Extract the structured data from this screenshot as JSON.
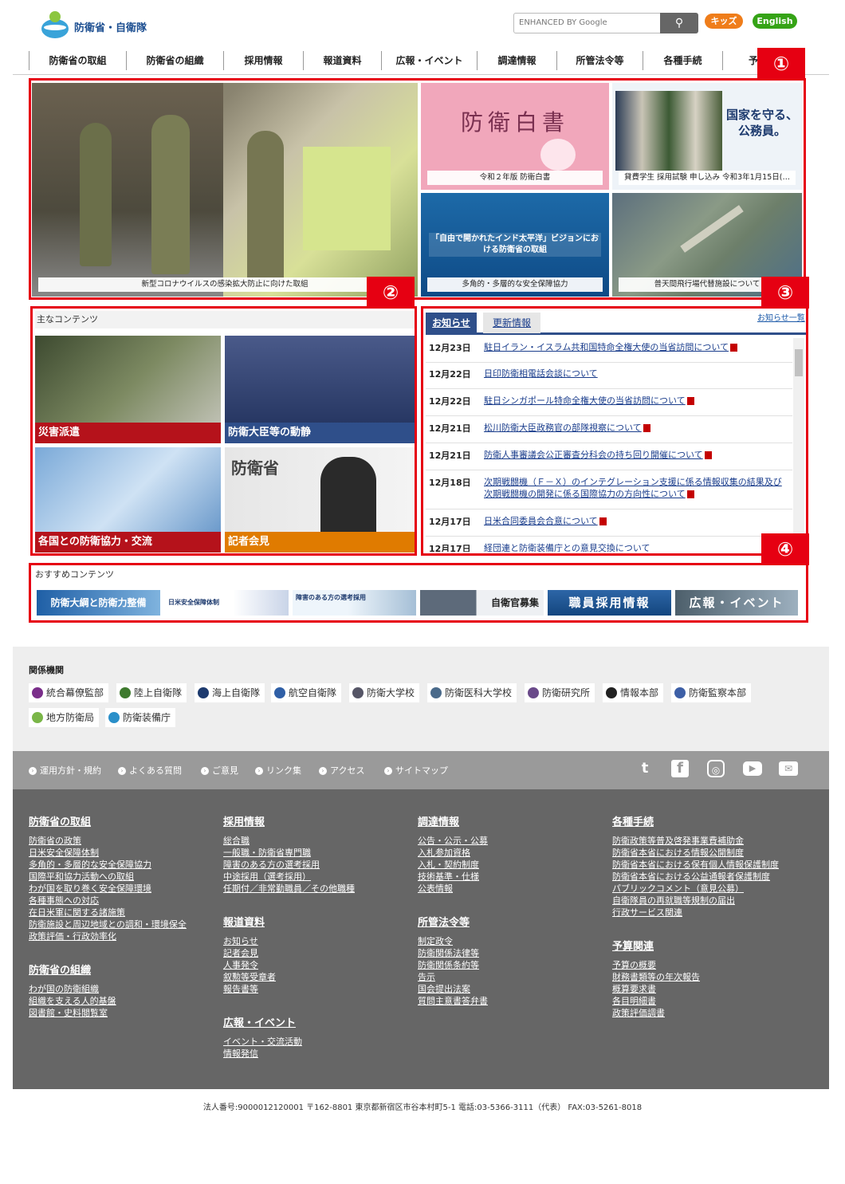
{
  "header": {
    "logo_text": "防衛省・自衛隊",
    "search_placeholder": "ENHANCED BY Google",
    "kids_label": "キッズ",
    "english_label": "English"
  },
  "global_nav": [
    "防衛省の取組",
    "防衛省の組織",
    "採用情報",
    "報道資料",
    "広報・イベント",
    "調達情報",
    "所管法令等",
    "各種手続",
    "予算"
  ],
  "markers": [
    "①",
    "②",
    "③",
    "④"
  ],
  "hero": {
    "main_caption": "新型コロナウイルスの感染拡大防止に向けた取組",
    "tiles": [
      {
        "caption": "令和２年版 防衛白書",
        "art_title": "防衛白書"
      },
      {
        "caption": "貸費学生 採用試験 申し込み 令和3年1月15日(…",
        "art_title": "国家を守る、公務員。"
      },
      {
        "caption": "多角的・多層的な安全保障協力",
        "art_title": "「自由で開かれたインド太平洋」ビジョンにおける防衛省の取組"
      },
      {
        "caption": "普天間飛行場代替施設について"
      }
    ]
  },
  "main_contents": {
    "title": "主なコンテンツ",
    "tiles": [
      "災害派遣",
      "防衛大臣等の動静",
      "各国との防衛協力・交流",
      "記者会見"
    ]
  },
  "news": {
    "tab_active": "お知らせ",
    "tab_inactive": "更新情報",
    "all_link": "お知らせ一覧",
    "items": [
      {
        "date": "12月23日",
        "title": "駐日イラン・イスラム共和国特命全権大使の当省訪問について",
        "pdf": true
      },
      {
        "date": "12月22日",
        "title": "日印防衛相電話会談について",
        "pdf": false
      },
      {
        "date": "12月22日",
        "title": "駐日シンガポール特命全権大使の当省訪問について",
        "pdf": true
      },
      {
        "date": "12月21日",
        "title": "松川防衛大臣政務官の部隊視察について",
        "pdf": true
      },
      {
        "date": "12月21日",
        "title": "防衛人事審議会公正審査分科会の持ち回り開催について",
        "pdf": true
      },
      {
        "date": "12月18日",
        "title": "次期戦闘機（Ｆ－Ｘ）のインテグレーション支援に係る情報収集の結果及び次期戦闘機の開発に係る国際協力の方向性について",
        "pdf": true
      },
      {
        "date": "12月17日",
        "title": "日米合同委員会合意について",
        "pdf": true
      },
      {
        "date": "12月17日",
        "title": "経団連と防衛装備庁との意見交換について",
        "pdf": false
      }
    ]
  },
  "recommended": {
    "title": "おすすめコンテンツ",
    "banners": [
      "防衛大綱と防衛力整備",
      "日米安全保障体制",
      "障害のある方の選考採用",
      "自衛官募集",
      "職員採用情報",
      "広報・イベント"
    ]
  },
  "related": {
    "title": "関係機関",
    "orgs": [
      "統合幕僚監部",
      "陸上自衛隊",
      "海上自衛隊",
      "航空自衛隊",
      "防衛大学校",
      "防衛医科大学校",
      "防衛研究所",
      "情報本部",
      "防衛監察本部",
      "地方防衛局",
      "防衛装備庁"
    ]
  },
  "utility_links": [
    "運用方針・規約",
    "よくある質問",
    "ご意見",
    "リンク集",
    "アクセス",
    "サイトマップ"
  ],
  "sns_icons": [
    "twitter-icon",
    "facebook-icon",
    "instagram-icon",
    "youtube-icon",
    "mail-icon"
  ],
  "footer": {
    "col1": [
      {
        "heading": "防衛省の取組",
        "links": [
          "防衛省の政策",
          "日米安全保障体制",
          "多角的・多層的な安全保障協力",
          "国際平和協力活動への取組",
          "わが国を取り巻く安全保障環境",
          "各種事態への対応",
          "在日米軍に関する諸施策",
          "防衛施設と周辺地域との調和・環境保全",
          "政策評価・行政効率化"
        ]
      },
      {
        "heading": "防衛省の組織",
        "links": [
          "わが国の防衛組織",
          "組織を支える人的基盤",
          "図書館・史料閲覧室"
        ]
      }
    ],
    "col2": [
      {
        "heading": "採用情報",
        "links": [
          "総合職",
          "一般職・防衛省専門職",
          "障害のある方の選考採用",
          "中途採用（選考採用）",
          "任期付／非常勤職員／その他職種"
        ]
      },
      {
        "heading": "報道資料",
        "links": [
          "お知らせ",
          "記者会見",
          "人事発令",
          "叙勲等受章者",
          "報告書等"
        ]
      },
      {
        "heading": "広報・イベント",
        "links": [
          "イベント・交流活動",
          "情報発信"
        ]
      }
    ],
    "col3": [
      {
        "heading": "調達情報",
        "links": [
          "公告・公示・公募",
          "入札参加資格",
          "入札・契約制度",
          "技術基準・仕様",
          "公表情報"
        ]
      },
      {
        "heading": "所管法令等",
        "links": [
          "制定政令",
          "防衛関係法律等",
          "防衛関係条約等",
          "告示",
          "国会提出法案",
          "質問主意書答弁書"
        ]
      }
    ],
    "col4": [
      {
        "heading": "各種手続",
        "links": [
          "防衛政策等普及啓発事業費補助金",
          "防衛省本省における情報公開制度",
          "防衛省本省における保有個人情報保護制度",
          "防衛省本省における公益通報者保護制度",
          "パブリックコメント（意見公募）",
          "自衛隊員の再就職等規制の届出",
          "行政サービス関連"
        ]
      },
      {
        "heading": "予算関連",
        "links": [
          "予算の概要",
          "財務書類等の年次報告",
          "概算要求書",
          "各目明細書",
          "政策評価調書"
        ]
      }
    ]
  },
  "address": "法人番号:9000012120001 〒162-8801 東京都新宿区市谷本村町5-1 電話:03-5366-3111（代表） FAX:03-5261-8018",
  "colors": {
    "highlight_red": "#e60012",
    "footer_gray": "#666666",
    "link_blue": "#1a3d8c",
    "kids_orange": "#ef7d1a",
    "english_green": "#35a316"
  }
}
